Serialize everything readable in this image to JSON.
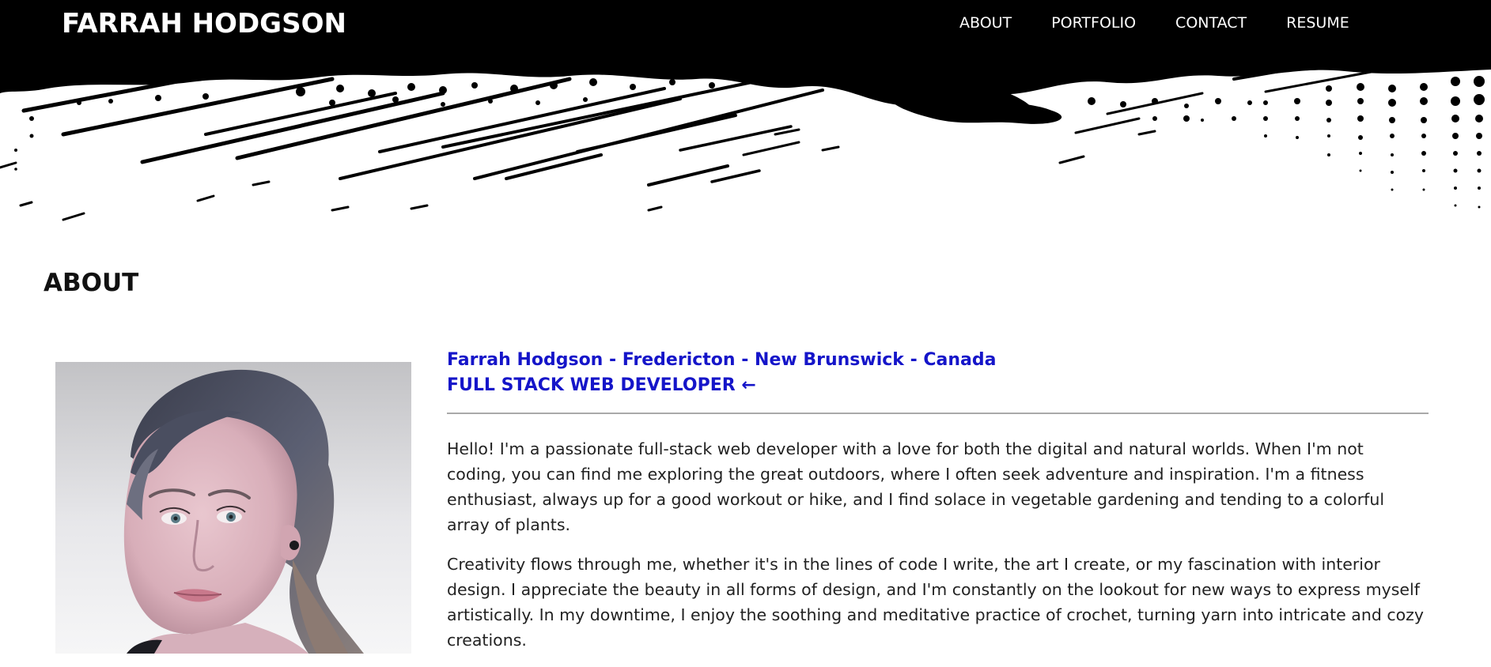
{
  "header": {
    "site_title": "FARRAH HODGSON",
    "nav": [
      {
        "label": "ABOUT"
      },
      {
        "label": "PORTFOLIO"
      },
      {
        "label": "CONTACT"
      },
      {
        "label": "RESUME"
      }
    ],
    "colors": {
      "band": "#000000",
      "text": "#ffffff"
    }
  },
  "about": {
    "heading": "ABOUT",
    "location": "Farrah Hodgson - Fredericton - New Brunswick - Canada",
    "role": "FULL STACK WEB DEVELOPER ←",
    "paragraphs": [
      "Hello! I'm a passionate full-stack web developer with a love for both the digital and natural worlds. When I'm not coding, you can find me exploring the great outdoors, where I often seek adventure and inspiration. I'm a fitness enthusiast, always up for a good workout or hike, and I find solace in vegetable gardening and tending to a colorful array of plants.",
      "Creativity flows through me, whether it's in the lines of code I write, the art I create, or my fascination with interior design. I appreciate the beauty in all forms of design, and I'm constantly on the lookout for new ways to express myself artistically. In my downtime, I enjoy the soothing and meditative practice of crochet, turning yarn into intricate and cozy creations."
    ],
    "colors": {
      "accent": "#1515c9",
      "rule": "#a9a9a9",
      "body_text": "#222222"
    }
  },
  "portrait": {
    "description_icon": "portrait-photo"
  }
}
